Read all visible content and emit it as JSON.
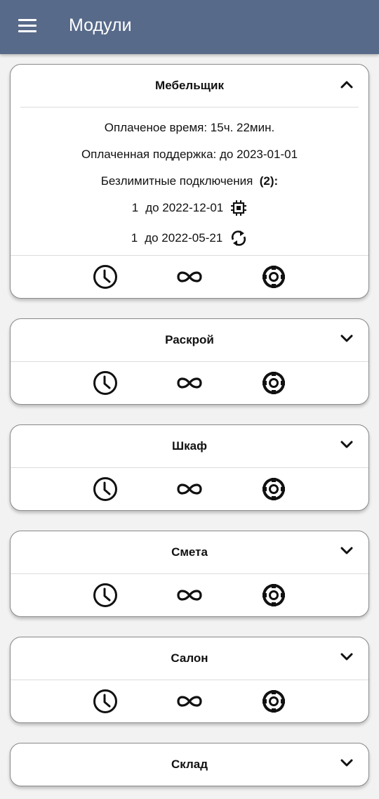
{
  "appbar": {
    "title": "Модули",
    "menu_icon": "menu-icon"
  },
  "colors": {
    "appbar": "#586a8a",
    "background": "#f2f2f2"
  },
  "modules": [
    {
      "name": "Мебельщик",
      "expanded": true,
      "paid_time": "Оплаченое время: 15ч. 22мин.",
      "paid_support": "Оплаченная поддержка: до 2023-01-01",
      "unlimited_label": "Безлимитные подключения",
      "unlimited_count": "(2):",
      "connections": [
        {
          "count": "1",
          "until": "до 2022-12-01",
          "icon": "chip-icon"
        },
        {
          "count": "1",
          "until": "до 2022-05-21",
          "icon": "refresh-icon"
        }
      ]
    },
    {
      "name": "Раскрой",
      "expanded": false
    },
    {
      "name": "Шкаф",
      "expanded": false
    },
    {
      "name": "Смета",
      "expanded": false
    },
    {
      "name": "Салон",
      "expanded": false
    },
    {
      "name": "Склад",
      "expanded": false
    }
  ],
  "action_icons": [
    "clock-icon",
    "infinity-icon",
    "lifebuoy-icon"
  ]
}
